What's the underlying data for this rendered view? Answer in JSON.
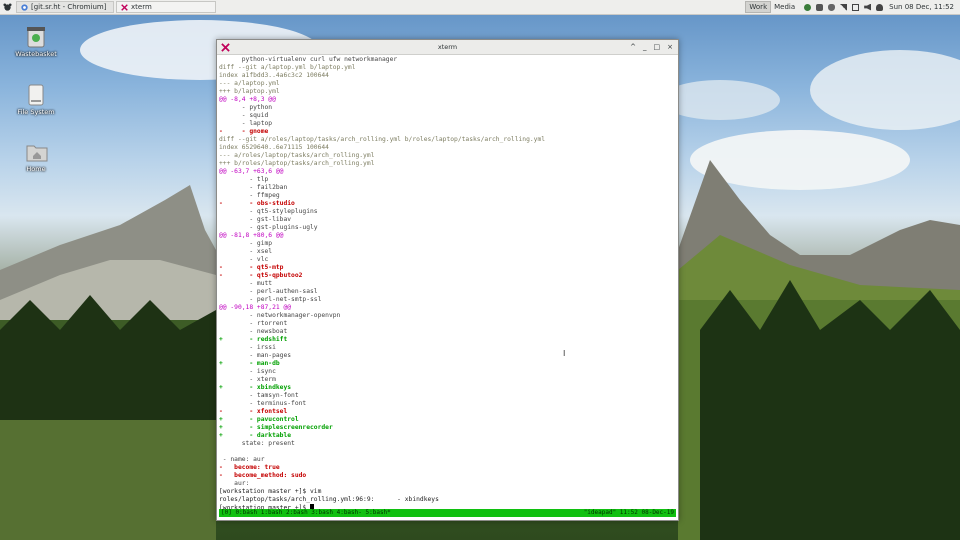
{
  "panel": {
    "tasks": [
      {
        "label": "[git.sr.ht - Chromium]",
        "icon": "chromium-icon"
      },
      {
        "label": "xterm",
        "icon": "xterm-icon"
      }
    ],
    "workspaces": [
      "Work",
      "Media"
    ],
    "clock": "Sun 08 Dec, 11:52"
  },
  "desktop": {
    "icons": [
      {
        "label": "Wastebasket",
        "icon": "trash-icon"
      },
      {
        "label": "File System",
        "icon": "drive-icon"
      },
      {
        "label": "Home",
        "icon": "home-folder-icon"
      }
    ]
  },
  "window": {
    "title": "xterm",
    "controls": [
      "^",
      "_",
      "□",
      "×"
    ]
  },
  "terminal": {
    "lines": [
      {
        "t": "      python-virtualenv curl ufw networkmanager",
        "c": "norm"
      },
      {
        "t": "diff --git a/laptop.yml b/laptop.yml",
        "c": "gray"
      },
      {
        "t": "index a1fbdd3..4a6c3c2 100644",
        "c": "gray"
      },
      {
        "t": "--- a/laptop.yml",
        "c": "gray"
      },
      {
        "t": "+++ b/laptop.yml",
        "c": "gray"
      },
      {
        "t": "@@ -8,4 +8,3 @@",
        "c": "mag"
      },
      {
        "t": "      - python",
        "c": "norm"
      },
      {
        "t": "      - squid",
        "c": "norm"
      },
      {
        "t": "      - laptop",
        "c": "norm"
      },
      {
        "t": "-     - gnome",
        "c": "red"
      },
      {
        "t": "diff --git a/roles/laptop/tasks/arch_rolling.yml b/roles/laptop/tasks/arch_rolling.yml",
        "c": "gray"
      },
      {
        "t": "index 6529640..6e71115 100644",
        "c": "gray"
      },
      {
        "t": "--- a/roles/laptop/tasks/arch_rolling.yml",
        "c": "gray"
      },
      {
        "t": "+++ b/roles/laptop/tasks/arch_rolling.yml",
        "c": "gray"
      },
      {
        "t": "@@ -63,7 +63,6 @@",
        "c": "mag"
      },
      {
        "t": "        - tlp",
        "c": "norm"
      },
      {
        "t": "        - fail2ban",
        "c": "norm"
      },
      {
        "t": "        - ffmpeg",
        "c": "norm"
      },
      {
        "t": "-       - obs-studio",
        "c": "red"
      },
      {
        "t": "        - qt5-styleplugins",
        "c": "norm"
      },
      {
        "t": "        - gst-libav",
        "c": "norm"
      },
      {
        "t": "        - gst-plugins-ugly",
        "c": "norm"
      },
      {
        "t": "@@ -81,8 +80,6 @@",
        "c": "mag"
      },
      {
        "t": "        - gimp",
        "c": "norm"
      },
      {
        "t": "        - xsel",
        "c": "norm"
      },
      {
        "t": "        - vlc",
        "c": "norm"
      },
      {
        "t": "-       - qt5-mtp",
        "c": "red"
      },
      {
        "t": "-       - qt5-qpbutoo2",
        "c": "red"
      },
      {
        "t": "        - mutt",
        "c": "norm"
      },
      {
        "t": "        - perl-authen-sasl",
        "c": "norm"
      },
      {
        "t": "        - perl-net-smtp-ssl",
        "c": "norm"
      },
      {
        "t": "@@ -90,18 +87,21 @@",
        "c": "mag"
      },
      {
        "t": "        - networkmanager-openvpn",
        "c": "norm"
      },
      {
        "t": "        - rtorrent",
        "c": "norm"
      },
      {
        "t": "        - newsboat",
        "c": "norm"
      },
      {
        "t": "+       - redshift",
        "c": "green"
      },
      {
        "t": "        - irssi",
        "c": "norm"
      },
      {
        "t": "        - man-pages",
        "c": "norm"
      },
      {
        "t": "+       - man-db",
        "c": "green"
      },
      {
        "t": "        - isync",
        "c": "norm"
      },
      {
        "t": "        - xterm",
        "c": "norm"
      },
      {
        "t": "+       - xbindkeys",
        "c": "green"
      },
      {
        "t": "        - tamsyn-font",
        "c": "norm"
      },
      {
        "t": "        - terminus-font",
        "c": "norm"
      },
      {
        "t": "-       - xfontsel",
        "c": "red"
      },
      {
        "t": "+       - pavucontrol",
        "c": "green"
      },
      {
        "t": "+       - simplescreenrecorder",
        "c": "green"
      },
      {
        "t": "+       - darktable",
        "c": "green"
      },
      {
        "t": "      state: present",
        "c": "norm"
      },
      {
        "t": "",
        "c": "norm"
      },
      {
        "t": " - name: aur",
        "c": "norm"
      },
      {
        "t": "-   become: true",
        "c": "red"
      },
      {
        "t": "-   become_method: sudo",
        "c": "red"
      },
      {
        "t": "    aur:",
        "c": "norm"
      },
      {
        "t": "[workstation master +]$ vim",
        "c": "cmd"
      },
      {
        "t": "roles/laptop/tasks/arch_rolling.yml:96:9:      - xbindkeys",
        "c": "cmd"
      },
      {
        "t": "[workstation master +]$ ",
        "c": "cmd",
        "cursor": true
      }
    ],
    "statusbar": {
      "left": "[0] 0:bash  1:bash  2:bash  3:bash  4:bash- 5:bash*",
      "right": "\"ideapad\" 11:52 08-Dec-19"
    }
  }
}
